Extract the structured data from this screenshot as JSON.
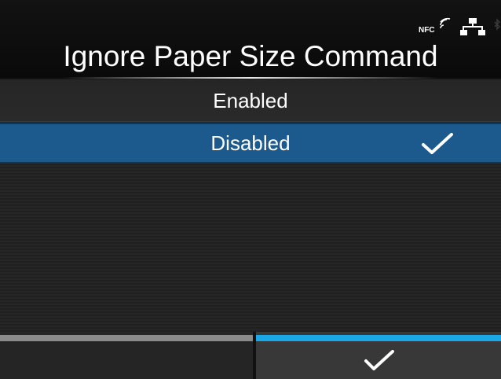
{
  "status_icons": {
    "nfc_label": "NFC",
    "icons": [
      "nfc-icon",
      "network-icon",
      "bluetooth-icon"
    ]
  },
  "header": {
    "title": "Ignore Paper Size Command"
  },
  "options": [
    {
      "label": "Enabled",
      "selected": false
    },
    {
      "label": "Disabled",
      "selected": true,
      "icon": "checkmark-icon"
    }
  ],
  "bottom_bar": {
    "left_button": {
      "label": "",
      "accent_color": "#8a8a8a"
    },
    "right_button": {
      "icon": "checkmark-icon",
      "accent_color": "#1aa8e8"
    }
  },
  "colors": {
    "selected_row": "#1c5a8e",
    "background": "#1a1a1a",
    "text": "#ffffff"
  }
}
